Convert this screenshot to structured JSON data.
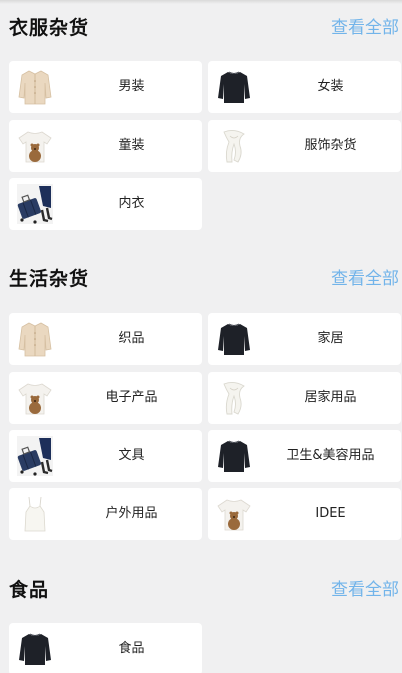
{
  "sections": [
    {
      "title": "衣服杂货",
      "view_all": "查看全部",
      "items": [
        {
          "label": "男装",
          "icon": "beige-cardigan-icon"
        },
        {
          "label": "女装",
          "icon": "black-sweater-icon"
        },
        {
          "label": "童装",
          "icon": "bear-tshirt-icon"
        },
        {
          "label": "服饰杂货",
          "icon": "white-scarf-icon"
        },
        {
          "label": "内衣",
          "icon": "suitcase-icon"
        }
      ]
    },
    {
      "title": "生活杂货",
      "view_all": "查看全部",
      "items": [
        {
          "label": "织品",
          "icon": "beige-cardigan-icon"
        },
        {
          "label": "家居",
          "icon": "black-sweater-icon"
        },
        {
          "label": "电子产品",
          "icon": "bear-tshirt-icon"
        },
        {
          "label": "居家用品",
          "icon": "white-scarf-icon"
        },
        {
          "label": "文具",
          "icon": "suitcase-icon"
        },
        {
          "label": "卫生&美容用品",
          "icon": "black-sweater-icon"
        },
        {
          "label": "户外用品",
          "icon": "white-camisole-icon"
        },
        {
          "label": "IDEE",
          "icon": "bear-tshirt-icon"
        }
      ]
    },
    {
      "title": "食品",
      "view_all": "查看全部",
      "items": [
        {
          "label": "食品",
          "icon": "black-sweater-icon"
        }
      ]
    }
  ],
  "colors": {
    "background": "#f0f0f1",
    "card": "#ffffff",
    "accent_link": "#72b4ea",
    "title": "#111111"
  }
}
